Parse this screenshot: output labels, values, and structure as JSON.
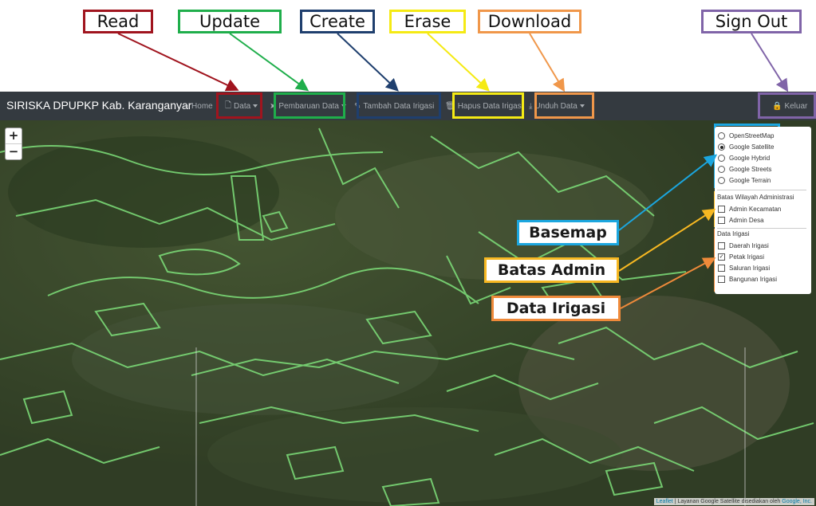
{
  "callouts": {
    "read": "Read",
    "update": "Update",
    "create": "Create",
    "erase": "Erase",
    "download": "Download",
    "sign_out": "Sign Out"
  },
  "navbar": {
    "brand": "SIRISKA DPUPKP Kab. Karanganyar",
    "home": "Home",
    "data": "Data",
    "pembaruan": "Pembaruan Data",
    "tambah": "Tambah Data Irigasi",
    "hapus": "Hapus Data Irigasi",
    "unduh": "Unduh Data",
    "keluar": "Keluar"
  },
  "layers": {
    "basemaps": [
      "OpenStreetMap",
      "Google Satellite",
      "Google Hybrid",
      "Google Streets",
      "Google Terrain"
    ],
    "selected_basemap": "Google Satellite",
    "admin_title": "Batas Wilayah Administrasi",
    "admin": [
      "Admin Kecamatan",
      "Admin Desa"
    ],
    "irigasi_title": "Data Irigasi",
    "irigasi": [
      "Daerah Irigasi",
      "Petak Irigasi",
      "Saluran Irigasi",
      "Bangunan Irigasi"
    ],
    "irigasi_checked": "Petak Irigasi"
  },
  "map_labels": {
    "basemap": "Basemap",
    "batas_admin": "Batas Admin",
    "data_irigasi": "Data Irigasi"
  },
  "zoom": {
    "in": "+",
    "out": "−"
  },
  "attribution": {
    "leaflet": "Leaflet",
    "text": " | Layanan Google Satellite disediakan oleh ",
    "google": "Google, Inc."
  },
  "colors": {
    "read": "#a0141e",
    "update": "#1fae4b",
    "create": "#1f3f6e",
    "erase": "#f5ea14",
    "download": "#f0974a",
    "sign_out": "#8064a8",
    "basemap": "#1ba6df",
    "batas_admin": "#f7b822",
    "data_irigasi": "#ef8a3a",
    "polygon": "#7ee07a"
  }
}
